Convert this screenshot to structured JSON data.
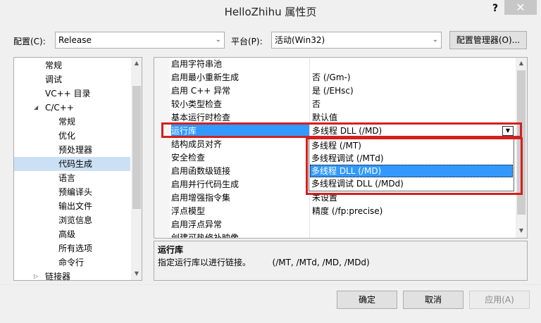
{
  "window": {
    "title": "HelloZhihu 属性页",
    "help": "?",
    "close": "✕"
  },
  "config": {
    "label": "配置(C):",
    "value": "Release"
  },
  "platform": {
    "label": "平台(P):",
    "value": "活动(Win32)"
  },
  "config_manager": "配置管理器(O)...",
  "tree": {
    "items": [
      {
        "label": "常规",
        "indent": 1
      },
      {
        "label": "调试",
        "indent": 1
      },
      {
        "label": "VC++ 目录",
        "indent": 1
      },
      {
        "label": "C/C++",
        "indent": 1,
        "expanded": true
      },
      {
        "label": "常规",
        "indent": 2
      },
      {
        "label": "优化",
        "indent": 2
      },
      {
        "label": "预处理器",
        "indent": 2
      },
      {
        "label": "代码生成",
        "indent": 2,
        "selected": true
      },
      {
        "label": "语言",
        "indent": 2
      },
      {
        "label": "预编译头",
        "indent": 2
      },
      {
        "label": "输出文件",
        "indent": 2
      },
      {
        "label": "浏览信息",
        "indent": 2
      },
      {
        "label": "高级",
        "indent": 2
      },
      {
        "label": "所有选项",
        "indent": 2
      },
      {
        "label": "命令行",
        "indent": 2
      },
      {
        "label": "链接器",
        "indent": 1,
        "collapsed": true
      }
    ]
  },
  "grid": {
    "rows": [
      {
        "name": "启用字符串池",
        "value": ""
      },
      {
        "name": "启用最小重新生成",
        "value": "否 (/Gm-)"
      },
      {
        "name": "启用 C++ 异常",
        "value": "是 (/EHsc)"
      },
      {
        "name": "较小类型检查",
        "value": "否"
      },
      {
        "name": "基本运行时检查",
        "value": "默认值"
      },
      {
        "name": "运行库",
        "value": "多线程 DLL (/MD)",
        "selected": true
      },
      {
        "name": "结构成员对齐",
        "value": ""
      },
      {
        "name": "安全检查",
        "value": ""
      },
      {
        "name": "启用函数级链接",
        "value": ""
      },
      {
        "name": "启用并行代码生成",
        "value": ""
      },
      {
        "name": "启用增强指令集",
        "value": "未设置"
      },
      {
        "name": "浮点模型",
        "value": "精度 (/fp:precise)"
      },
      {
        "name": "启用浮点异常",
        "value": ""
      },
      {
        "name": "创建可热修补映像",
        "value": ""
      }
    ]
  },
  "dropdown": {
    "options": [
      {
        "label": "多线程 (/MT)"
      },
      {
        "label": "多线程调试 (/MTd)"
      },
      {
        "label": "多线程 DLL (/MD)",
        "selected": true
      },
      {
        "label": "多线程调试 DLL (/MDd)"
      }
    ]
  },
  "description": {
    "title": "运行库",
    "text": "指定运行库以进行链接。        (/MT, /MTd, /MD, /MDd)"
  },
  "buttons": {
    "ok": "确定",
    "cancel": "取消",
    "apply": "应用(A)"
  },
  "colors": {
    "selection": "#3399ff",
    "highlight": "#d41f1f",
    "tree_selection": "#cce0f5"
  }
}
